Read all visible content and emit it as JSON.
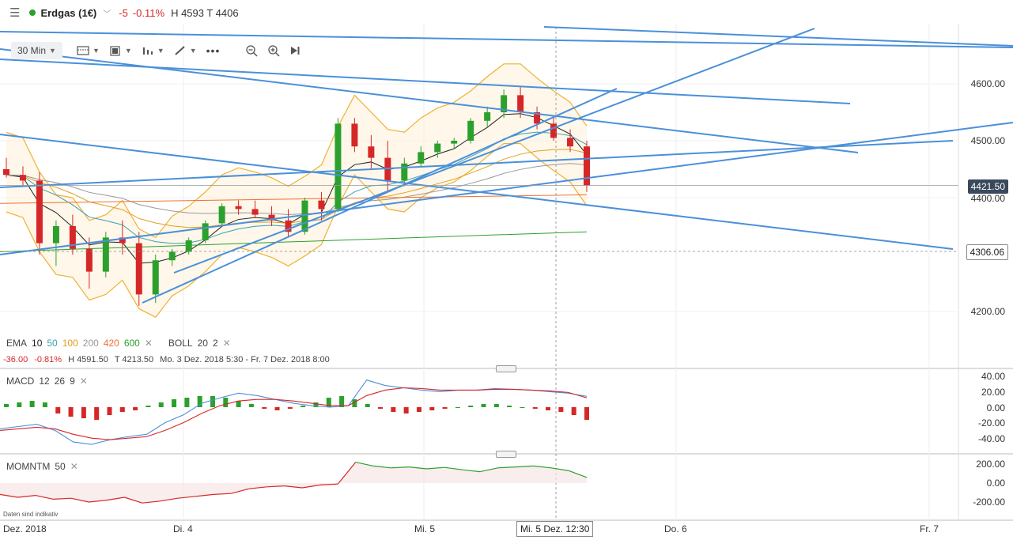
{
  "header": {
    "menu_icon": "hamburger-menu-icon",
    "instrument": "Erdgas (1€)",
    "change": "-5",
    "change_pct": "-0.11%",
    "high_low": "H 4593 T 4406",
    "status_color": "#2ca02c"
  },
  "toolbar": {
    "timeframe": "30 Min",
    "icons": [
      "chart-type-icon",
      "indicators-icon",
      "bar-style-icon",
      "drawing-pencil-icon",
      "more-icon",
      "zoom-out-icon",
      "zoom-in-icon",
      "jump-to-end-icon"
    ]
  },
  "legend_main": {
    "ema_label": "EMA",
    "ema10": "10",
    "ema50": "50",
    "ema100": "100",
    "ema200": "200",
    "ema420": "420",
    "ema600": "600",
    "boll_label": "BOLL",
    "boll_period": "20",
    "boll_dev": "2"
  },
  "info": {
    "change": "-36.00",
    "change_pct": "-0.81%",
    "high": "H 4591.50",
    "low": "T 4213.50",
    "range": "Mo. 3 Dez. 2018 5:30 - Fr. 7 Dez. 2018 8:00"
  },
  "macd": {
    "label": "MACD",
    "fast": "12",
    "slow": "26",
    "signal": "9",
    "axis": [
      "40.00",
      "20.00",
      "0.00",
      "-20.00",
      "-40.00"
    ]
  },
  "momentum": {
    "label": "MOMNTM",
    "period": "50",
    "axis": [
      "200.00",
      "0.00",
      "-200.00"
    ],
    "note": "Daten sind indikativ"
  },
  "price_axis": {
    "ticks": [
      "4600.00",
      "4500.00",
      "4400.00",
      "4200.00"
    ],
    "current_price": "4421.50",
    "crosshair_price": "4306.06"
  },
  "time_axis": {
    "labels": [
      "Dez. 2018",
      "Di. 4",
      "Mi. 5",
      "Do. 6",
      "Fr. 7"
    ],
    "crosshair_time": "Mi. 5 Dez. 12:30"
  },
  "colors": {
    "up": "#2ca02c",
    "down": "#d62728",
    "trendline": "#4a90d9",
    "ema10": "#222222",
    "ema50": "#3aa0b0",
    "ema100": "#e0a020",
    "ema200": "#999999",
    "ema420": "#f07030",
    "ema600": "#2ca02c",
    "boll": "#f0b030",
    "macd_line": "#4a90d9",
    "signal_line": "#d62728"
  },
  "chart_data": {
    "type": "candlestick",
    "interval": "30 Min",
    "title": "Erdgas (1€)",
    "price_range": [
      4160,
      4680
    ],
    "candles_ohlc_sample": [
      [
        4450,
        4470,
        4435,
        4440
      ],
      [
        4440,
        4455,
        4420,
        4430
      ],
      [
        4430,
        4445,
        4300,
        4320
      ],
      [
        4320,
        4360,
        4280,
        4350
      ],
      [
        4350,
        4370,
        4300,
        4310
      ],
      [
        4310,
        4330,
        4240,
        4270
      ],
      [
        4270,
        4340,
        4260,
        4330
      ],
      [
        4330,
        4360,
        4300,
        4320
      ],
      [
        4320,
        4340,
        4210,
        4230
      ],
      [
        4230,
        4300,
        4215,
        4290
      ],
      [
        4290,
        4310,
        4280,
        4305
      ],
      [
        4305,
        4330,
        4300,
        4325
      ],
      [
        4325,
        4360,
        4320,
        4355
      ],
      [
        4355,
        4390,
        4350,
        4385
      ],
      [
        4385,
        4395,
        4370,
        4380
      ],
      [
        4380,
        4395,
        4365,
        4370
      ],
      [
        4370,
        4385,
        4350,
        4360
      ],
      [
        4360,
        4380,
        4330,
        4340
      ],
      [
        4340,
        4400,
        4335,
        4395
      ],
      [
        4395,
        4410,
        4360,
        4380
      ],
      [
        4380,
        4540,
        4375,
        4530
      ],
      [
        4530,
        4540,
        4480,
        4490
      ],
      [
        4490,
        4510,
        4450,
        4470
      ],
      [
        4470,
        4500,
        4410,
        4430
      ],
      [
        4430,
        4470,
        4420,
        4460
      ],
      [
        4460,
        4490,
        4455,
        4480
      ],
      [
        4480,
        4500,
        4470,
        4495
      ],
      [
        4495,
        4505,
        4485,
        4500
      ],
      [
        4500,
        4540,
        4495,
        4535
      ],
      [
        4535,
        4560,
        4525,
        4550
      ],
      [
        4550,
        4590,
        4540,
        4580
      ],
      [
        4580,
        4595,
        4540,
        4550
      ],
      [
        4550,
        4560,
        4520,
        4530
      ],
      [
        4530,
        4545,
        4500,
        4505
      ],
      [
        4505,
        4520,
        4480,
        4490
      ],
      [
        4490,
        4500,
        4410,
        4421.5
      ]
    ],
    "macd_range": [
      -50,
      50
    ],
    "momentum_range": [
      -250,
      250
    ]
  }
}
